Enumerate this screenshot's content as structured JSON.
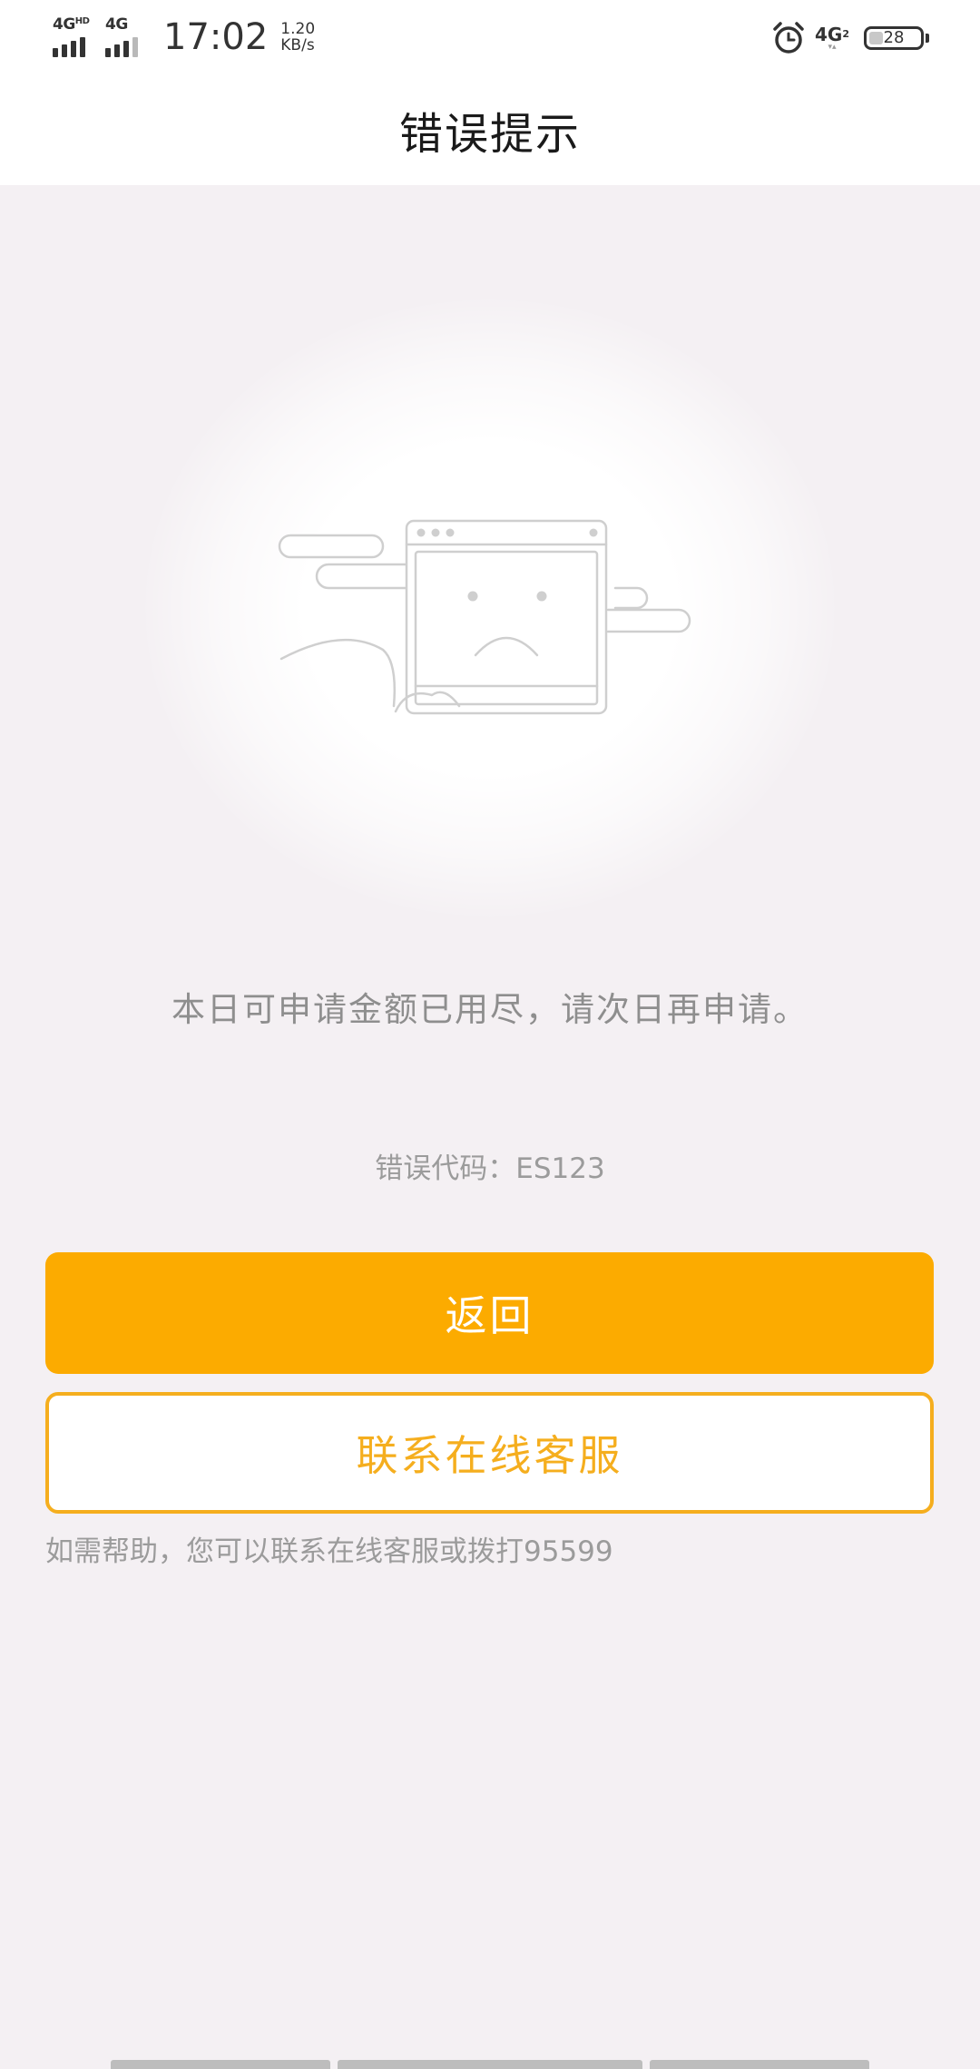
{
  "status_bar": {
    "net1_label": "4G",
    "net1_sup": "HD",
    "net2_label": "4G",
    "time": "17:02",
    "speed_value": "1.20",
    "speed_unit": "KB/s",
    "right_net_label": "4G",
    "right_net_sub": "2",
    "battery_level": "28",
    "battery_percent": 28
  },
  "header": {
    "title": "错误提示"
  },
  "error": {
    "message": "本日可申请金额已用尽，请次日再申请。",
    "code_text": "错误代码：ES123"
  },
  "actions": {
    "back_label": "返回",
    "contact_label": "联系在线客服"
  },
  "help": {
    "text": "如需帮助，您可以联系在线客服或拨打95599"
  },
  "colors": {
    "accent": "#fcab00",
    "outline_accent": "#f5ae1e",
    "background": "#f4f0f3",
    "muted_text": "#9b9b9b"
  },
  "icons": {
    "illustration": "sad-browser-window-illustration",
    "alarm": "alarm-clock-icon"
  }
}
